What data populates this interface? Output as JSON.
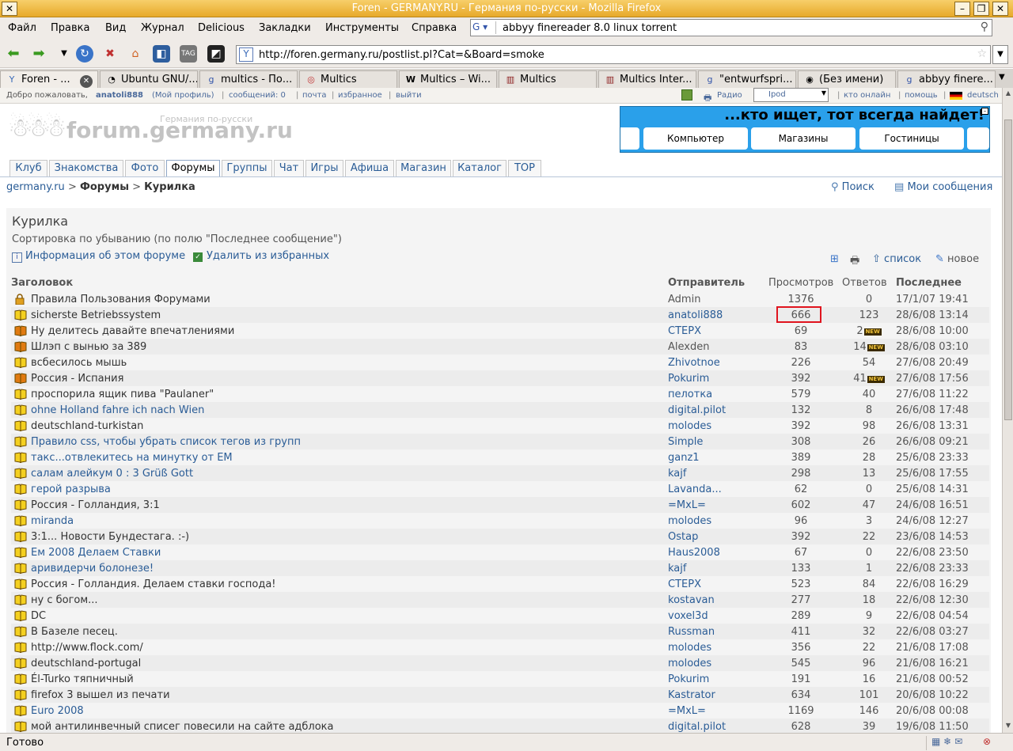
{
  "window": {
    "title": "Foren - GERMANY.RU - Германия по-русски - Mozilla Firefox"
  },
  "menu": [
    "Файл",
    "Правка",
    "Вид",
    "Журнал",
    "Delicious",
    "Закладки",
    "Инструменты",
    "Справка"
  ],
  "search": {
    "value": "abbyy finereader 8.0 linux torrent"
  },
  "url": "http://foren.germany.ru/postlist.pl?Cat=&Board=smoke",
  "tabs": [
    {
      "label": "Foren - ...",
      "active": true
    },
    {
      "label": "Ubuntu GNU/..."
    },
    {
      "label": "multics - По..."
    },
    {
      "label": "Multics"
    },
    {
      "label": "Multics – Wi..."
    },
    {
      "label": "Multics"
    },
    {
      "label": "Multics Inter..."
    },
    {
      "label": "\"entwurfspri..."
    },
    {
      "label": "(Без имени)"
    },
    {
      "label": "abbyy finere..."
    }
  ],
  "sitebar": {
    "welcome": "Добро пожаловать,",
    "user": "anatoli888",
    "profile": "(Мой профиль)",
    "messages": "сообщений: 0",
    "mail": "почта",
    "favorites": "избранное",
    "logout": "выйти",
    "radio": "Радио",
    "ipod": "Ipod",
    "online": "кто онлайн",
    "help": "помощь",
    "lang": "deutsch"
  },
  "logo": {
    "name": "forum.germany.ru",
    "sub": "Германия по-русски"
  },
  "banner": {
    "slogan": "...кто ищет, тот всегда найдет!",
    "buttons": [
      "Компьютер",
      "Магазины",
      "Гостиницы"
    ]
  },
  "site_tabs": [
    "Клуб",
    "Знакомства",
    "Фото",
    "Форумы",
    "Группы",
    "Чат",
    "Игры",
    "Афиша",
    "Магазин",
    "Каталог",
    "TOP"
  ],
  "breadcrumb": {
    "home": "germany.ru",
    "sep": ">",
    "forums": "Форумы",
    "current": "Курилка"
  },
  "topright": {
    "search": "Поиск",
    "mymessages": "Мои сообщения"
  },
  "forum": {
    "title": "Курилка",
    "sort": "Сортировка по убыванию (по полю \"Последнее сообщение\")",
    "info": "Информация об этом форуме",
    "remove_fav": "Удалить из избранных",
    "list": "список",
    "new": "новое"
  },
  "table": {
    "headers": {
      "topic": "Заголовок",
      "sender": "Отправитель",
      "views": "Просмотров",
      "replies": "Ответов",
      "last": "Последнее"
    },
    "new_badge": "NEW",
    "rows": [
      {
        "topic": "Правила Пользования Форумами",
        "sender": "Admin",
        "views": "1376",
        "replies": "0",
        "last": "17/1/07 19:41",
        "icon": "lock",
        "link": false,
        "sender_plain": true
      },
      {
        "topic": "sicherste Betriebssystem",
        "sender": "anatoli888",
        "views": "666",
        "replies": "123",
        "last": "28/6/08 13:14",
        "icon": "book"
      },
      {
        "topic": "Ну делитесь давайте впечатлениями",
        "sender": "CTEPX",
        "views": "69",
        "replies": "2",
        "new": true,
        "last": "28/6/08 10:00",
        "icon": "hot"
      },
      {
        "topic": "Шлэп с вынью за 389",
        "sender": "Alexden",
        "views": "83",
        "replies": "14",
        "new": true,
        "last": "28/6/08 03:10",
        "icon": "hot",
        "sender_plain": true
      },
      {
        "topic": "всбесилось мышь",
        "sender": "Zhivotnoe",
        "views": "226",
        "replies": "54",
        "last": "27/6/08 20:49",
        "icon": "book"
      },
      {
        "topic": "Россия - Испания",
        "sender": "Pokurim",
        "views": "392",
        "replies": "41",
        "new": true,
        "last": "27/6/08 17:56",
        "icon": "hot"
      },
      {
        "topic": "проспорила ящик пива \"Paulaner\"",
        "sender": "пелотка",
        "views": "579",
        "replies": "40",
        "last": "27/6/08 11:22",
        "icon": "book"
      },
      {
        "topic": "ohne Holland fahre ich nach Wien",
        "sender": "digital.pilot",
        "views": "132",
        "replies": "8",
        "last": "26/6/08 17:48",
        "icon": "book",
        "link": true
      },
      {
        "topic": "deutschland-turkistan",
        "sender": "molodes",
        "views": "392",
        "replies": "98",
        "last": "26/6/08 13:31",
        "icon": "book"
      },
      {
        "topic": "Правило css, чтобы убрать список тегов из групп",
        "sender": "Simple",
        "views": "308",
        "replies": "26",
        "last": "26/6/08 09:21",
        "icon": "book",
        "link": true
      },
      {
        "topic": "такс...отвлекитесь на минутку от ЕМ",
        "sender": "ganz1",
        "views": "389",
        "replies": "28",
        "last": "25/6/08 23:33",
        "icon": "book",
        "link": true
      },
      {
        "topic": "салам алейкум 0 : 3 Grüß Gott",
        "sender": "kajf",
        "views": "298",
        "replies": "13",
        "last": "25/6/08 17:55",
        "icon": "book",
        "link": true
      },
      {
        "topic": "герой разрыва",
        "sender": "Lavanda...",
        "views": "62",
        "replies": "0",
        "last": "25/6/08 14:31",
        "icon": "book",
        "link": true
      },
      {
        "topic": "Россия - Голландия, 3:1",
        "sender": "=MxL=",
        "views": "602",
        "replies": "47",
        "last": "24/6/08 16:51",
        "icon": "book"
      },
      {
        "topic": "miranda",
        "sender": "molodes",
        "views": "96",
        "replies": "3",
        "last": "24/6/08 12:27",
        "icon": "book",
        "link": true
      },
      {
        "topic": "3:1... Новости Бундестага. :-)",
        "sender": "Ostap",
        "views": "392",
        "replies": "22",
        "last": "23/6/08 14:53",
        "icon": "book"
      },
      {
        "topic": "Ем 2008 Делаем Ставки",
        "sender": "Haus2008",
        "views": "67",
        "replies": "0",
        "last": "22/6/08 23:50",
        "icon": "book",
        "link": true
      },
      {
        "topic": "аривидерчи болонезе!",
        "sender": "kajf",
        "views": "133",
        "replies": "1",
        "last": "22/6/08 23:33",
        "icon": "book",
        "link": true
      },
      {
        "topic": "Россия - Голландия. Делаем ставки господа!",
        "sender": "CTEPX",
        "views": "523",
        "replies": "84",
        "last": "22/6/08 16:29",
        "icon": "book"
      },
      {
        "topic": "ну с богом...",
        "sender": "kostavan",
        "views": "277",
        "replies": "18",
        "last": "22/6/08 12:30",
        "icon": "book"
      },
      {
        "topic": "DC",
        "sender": "voxel3d",
        "views": "289",
        "replies": "9",
        "last": "22/6/08 04:54",
        "icon": "book"
      },
      {
        "topic": "В Базеле песец.",
        "sender": "Russman",
        "views": "411",
        "replies": "32",
        "last": "22/6/08 03:27",
        "icon": "book"
      },
      {
        "topic": "http://www.flock.com/",
        "sender": "molodes",
        "views": "356",
        "replies": "22",
        "last": "21/6/08 17:08",
        "icon": "book"
      },
      {
        "topic": "deutschland-portugal",
        "sender": "molodes",
        "views": "545",
        "replies": "96",
        "last": "21/6/08 16:21",
        "icon": "book"
      },
      {
        "topic": "Él-Turko тяпничный",
        "sender": "Pokurim",
        "views": "191",
        "replies": "16",
        "last": "21/6/08 00:52",
        "icon": "book"
      },
      {
        "topic": "firefox 3 вышел из печати",
        "sender": "Kastrator",
        "views": "634",
        "replies": "101",
        "last": "20/6/08 10:22",
        "icon": "book"
      },
      {
        "topic": "Euro 2008",
        "sender": "=MxL=",
        "views": "1169",
        "replies": "146",
        "last": "20/6/08 00:08",
        "icon": "book",
        "link": true
      },
      {
        "topic": "мой антилинвечный списег повесили на сайте адблока",
        "sender": "digital.pilot",
        "views": "628",
        "replies": "39",
        "last": "19/6/08 11:50",
        "icon": "book"
      }
    ]
  },
  "status": {
    "text": "Готово"
  },
  "colors": {
    "link": "#2a5c96",
    "titlebar": "#e7a92a",
    "highlight": "#e0141e",
    "banner": "#2aa0ea"
  }
}
